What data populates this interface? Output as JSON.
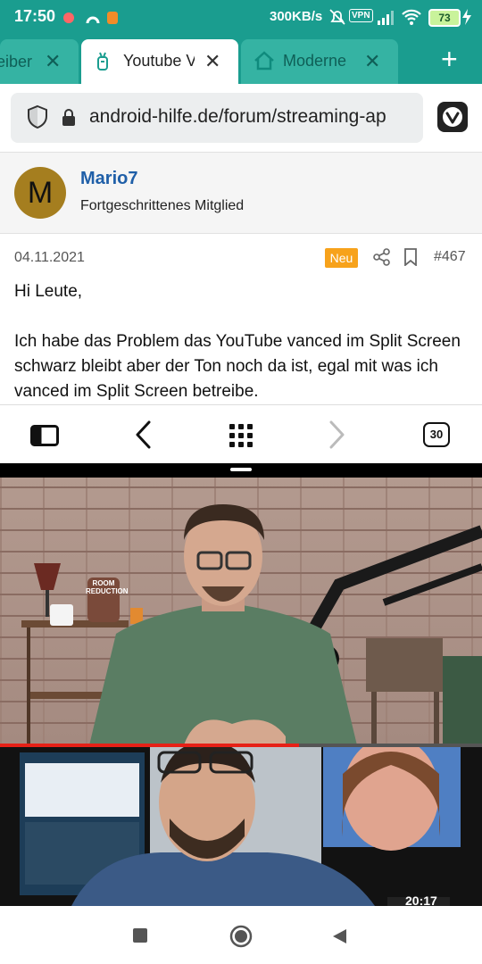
{
  "status_bar": {
    "time": "17:50",
    "network_speed": "300KB/s",
    "vpn": "VPN",
    "battery": "73"
  },
  "tabs": [
    {
      "label": "eiber",
      "active": false
    },
    {
      "label": "Youtube V",
      "active": true
    },
    {
      "label": "Moderne V",
      "active": false
    }
  ],
  "address_bar": {
    "url": "android-hilfe.de/forum/streaming-ap"
  },
  "post": {
    "avatar_letter": "M",
    "username": "Mario7",
    "user_role": "Fortgeschrittenes Mitglied",
    "date": "04.11.2021",
    "badge": "Neu",
    "post_number": "#467",
    "greeting": "Hi Leute,",
    "body": "Ich habe das Problem das YouTube vanced im Split Screen schwarz bleibt aber der Ton noch da ist, egal mit was ich vanced im Split Screen betreibe."
  },
  "toolbar": {
    "tab_count": "30"
  },
  "video": {
    "progress": 0.62,
    "duration_fragment": "20:17",
    "poster_text": "ROOM REDUCTION"
  },
  "colors": {
    "status_bar": "#1a9d8f",
    "link_blue": "#1f5fa8",
    "badge_orange": "#f7a21b",
    "progress_red": "#e62117"
  }
}
